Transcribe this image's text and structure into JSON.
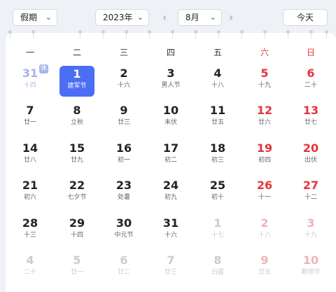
{
  "toolbar": {
    "holiday_label": "假期",
    "year_label": "2023年",
    "month_label": "8月",
    "today_label": "今天",
    "prev_icon": "chevron-left-icon",
    "next_icon": "chevron-right-icon",
    "dropdown_icon": "chevron-down-icon"
  },
  "badge": {
    "label": "休"
  },
  "weekdays": [
    "一",
    "二",
    "三",
    "四",
    "五",
    "六",
    "日"
  ],
  "colors": {
    "accent": "#4c6ef5",
    "weekend": "#e5343c",
    "background": "#eef1f6"
  },
  "days": [
    {
      "d": "31",
      "l": "十四",
      "state": "prev"
    },
    {
      "d": "1",
      "l": "建军节",
      "state": "selected"
    },
    {
      "d": "2",
      "l": "十六"
    },
    {
      "d": "3",
      "l": "男人节"
    },
    {
      "d": "4",
      "l": "十八"
    },
    {
      "d": "5",
      "l": "十九"
    },
    {
      "d": "6",
      "l": "二十"
    },
    {
      "d": "7",
      "l": "廿一"
    },
    {
      "d": "8",
      "l": "立秋"
    },
    {
      "d": "9",
      "l": "廿三"
    },
    {
      "d": "10",
      "l": "末伏"
    },
    {
      "d": "11",
      "l": "廿五"
    },
    {
      "d": "12",
      "l": "廿六"
    },
    {
      "d": "13",
      "l": "廿七"
    },
    {
      "d": "14",
      "l": "廿八"
    },
    {
      "d": "15",
      "l": "廿九"
    },
    {
      "d": "16",
      "l": "初一"
    },
    {
      "d": "17",
      "l": "初二"
    },
    {
      "d": "18",
      "l": "初三"
    },
    {
      "d": "19",
      "l": "初四"
    },
    {
      "d": "20",
      "l": "出伏"
    },
    {
      "d": "21",
      "l": "初六"
    },
    {
      "d": "22",
      "l": "七夕节"
    },
    {
      "d": "23",
      "l": "处暑"
    },
    {
      "d": "24",
      "l": "初九"
    },
    {
      "d": "25",
      "l": "初十"
    },
    {
      "d": "26",
      "l": "十一"
    },
    {
      "d": "27",
      "l": "十二"
    },
    {
      "d": "28",
      "l": "十三"
    },
    {
      "d": "29",
      "l": "十四"
    },
    {
      "d": "30",
      "l": "中元节"
    },
    {
      "d": "31",
      "l": "十六"
    },
    {
      "d": "1",
      "l": "十七",
      "state": "next"
    },
    {
      "d": "2",
      "l": "十八",
      "state": "next"
    },
    {
      "d": "3",
      "l": "十九",
      "state": "next"
    },
    {
      "d": "4",
      "l": "二十",
      "state": "next"
    },
    {
      "d": "5",
      "l": "廿一",
      "state": "next"
    },
    {
      "d": "6",
      "l": "廿二",
      "state": "next"
    },
    {
      "d": "7",
      "l": "廿三",
      "state": "next"
    },
    {
      "d": "8",
      "l": "白露",
      "state": "next"
    },
    {
      "d": "9",
      "l": "廿五",
      "state": "next"
    },
    {
      "d": "10",
      "l": "教师节",
      "state": "next"
    }
  ]
}
